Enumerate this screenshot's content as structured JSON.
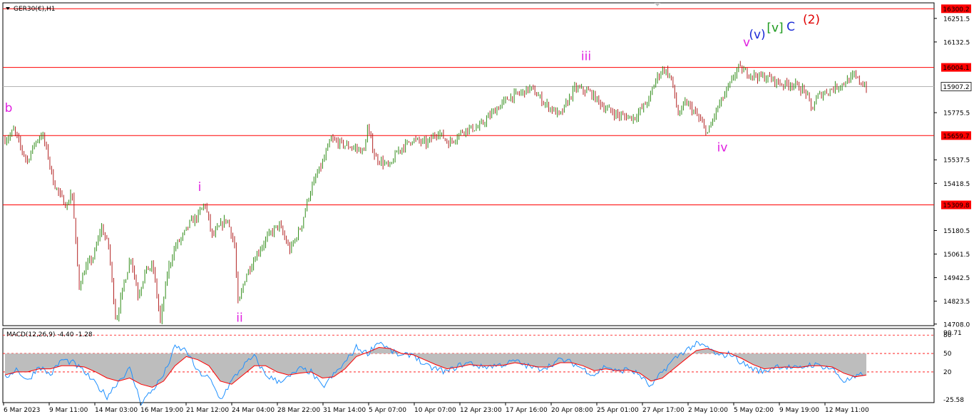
{
  "header": {
    "symbol_label": "GER30(€),H1",
    "macd_label": "MACD(12,26,9) -4.40 -1.28"
  },
  "colors": {
    "up_candle": "#2e8b16",
    "down_candle": "#b22222",
    "level_line": "#ff0000",
    "current_line": "#b4b4b4",
    "macd_hist": "#bdbdbd",
    "macd_main": "#1e90ff",
    "macd_signal": "#ff0000",
    "wave_magenta": "#e020e0",
    "wave_blue": "#1a2ad6",
    "wave_green": "#1c9a1c",
    "wave_red": "#e00000"
  },
  "chart_data": [
    {
      "type": "candlestick",
      "symbol": "GER30(€),H1",
      "ylim": [
        14700,
        16330
      ],
      "y_ticks": [
        "16251.5",
        "16132.5",
        "15775.5",
        "15537.5",
        "15418.5",
        "15180.5",
        "15061.5",
        "14942.5",
        "14823.5",
        "14708.0"
      ],
      "x_tick_labels": [
        "6 Mar 2023",
        "9 Mar 11:00",
        "14 Mar 03:00",
        "16 Mar 19:00",
        "21 Mar 12:00",
        "24 Mar 04:00",
        "28 Mar 22:00",
        "31 Mar 14:00",
        "5 Apr 07:00",
        "10 Apr 07:00",
        "12 Apr 23:00",
        "17 Apr 16:00",
        "20 Apr 08:00",
        "25 Apr 01:00",
        "27 Apr 17:00",
        "2 May 10:00",
        "5 May 02:00",
        "9 May 19:00",
        "12 May 11:00"
      ],
      "price_path": [
        [
          0,
          15640
        ],
        [
          0.007,
          15660
        ],
        [
          0.012,
          15690
        ],
        [
          0.02,
          15610
        ],
        [
          0.03,
          15530
        ],
        [
          0.04,
          15620
        ],
        [
          0.05,
          15670
        ],
        [
          0.058,
          15560
        ],
        [
          0.065,
          15430
        ],
        [
          0.075,
          15350
        ],
        [
          0.085,
          15300
        ],
        [
          0.09,
          15400
        ],
        [
          0.1,
          14900
        ],
        [
          0.11,
          15000
        ],
        [
          0.12,
          15050
        ],
        [
          0.13,
          15200
        ],
        [
          0.14,
          15100
        ],
        [
          0.15,
          14720
        ],
        [
          0.16,
          14900
        ],
        [
          0.17,
          15050
        ],
        [
          0.18,
          14850
        ],
        [
          0.19,
          14980
        ],
        [
          0.2,
          15000
        ],
        [
          0.21,
          14720
        ],
        [
          0.22,
          14980
        ],
        [
          0.23,
          15100
        ],
        [
          0.24,
          15150
        ],
        [
          0.25,
          15220
        ],
        [
          0.26,
          15250
        ],
        [
          0.27,
          15320
        ],
        [
          0.28,
          15150
        ],
        [
          0.29,
          15200
        ],
        [
          0.3,
          15240
        ],
        [
          0.31,
          15110
        ],
        [
          0.315,
          14800
        ],
        [
          0.325,
          14950
        ],
        [
          0.34,
          15060
        ],
        [
          0.355,
          15150
        ],
        [
          0.37,
          15210
        ],
        [
          0.385,
          15080
        ],
        [
          0.4,
          15200
        ],
        [
          0.41,
          15350
        ],
        [
          0.42,
          15450
        ],
        [
          0.43,
          15530
        ],
        [
          0.44,
          15640
        ],
        [
          0.46,
          15610
        ],
        [
          0.47,
          15600
        ],
        [
          0.485,
          15580
        ],
        [
          0.49,
          15700
        ],
        [
          0.5,
          15550
        ],
        [
          0.52,
          15500
        ],
        [
          0.53,
          15580
        ],
        [
          0.55,
          15640
        ],
        [
          0.57,
          15620
        ],
        [
          0.585,
          15680
        ],
        [
          0.6,
          15620
        ],
        [
          0.62,
          15690
        ],
        [
          0.64,
          15700
        ],
        [
          0.66,
          15780
        ],
        [
          0.68,
          15850
        ],
        [
          0.7,
          15880
        ],
        [
          0.71,
          15900
        ],
        [
          0.73,
          15820
        ],
        [
          0.75,
          15760
        ],
        [
          0.77,
          15900
        ],
        [
          0.79,
          15880
        ],
        [
          0.81,
          15800
        ],
        [
          0.83,
          15760
        ],
        [
          0.85,
          15750
        ],
        [
          0.87,
          15840
        ],
        [
          0.88,
          15950
        ],
        [
          0.89,
          16000
        ],
        [
          0.9,
          15950
        ],
        [
          0.91,
          15760
        ],
        [
          0.92,
          15830
        ],
        [
          0.935,
          15760
        ],
        [
          0.95,
          15670
        ],
        [
          0.96,
          15780
        ],
        [
          0.97,
          15850
        ],
        [
          0.98,
          15920
        ],
        [
          0.99,
          16004
        ],
        [
          1.0,
          15980
        ]
      ],
      "price_path_2": [
        [
          0,
          15980
        ],
        [
          0.1,
          15960
        ],
        [
          0.2,
          15950
        ],
        [
          0.3,
          15920
        ],
        [
          0.4,
          15920
        ],
        [
          0.5,
          15880
        ],
        [
          0.55,
          15790
        ],
        [
          0.6,
          15860
        ],
        [
          0.7,
          15890
        ],
        [
          0.8,
          15920
        ],
        [
          0.9,
          15960
        ],
        [
          0.95,
          15930
        ],
        [
          1.0,
          15907
        ]
      ],
      "levels": [
        {
          "value": 16300.2,
          "label": "16300.2",
          "kind": "resistance"
        },
        {
          "value": 16004.1,
          "label": "16004.1",
          "kind": "resistance"
        },
        {
          "value": 15907.2,
          "label": "15907.2",
          "kind": "current"
        },
        {
          "value": 15659.7,
          "label": "15659.7",
          "kind": "support"
        },
        {
          "value": 15309.8,
          "label": "15309.8",
          "kind": "support"
        }
      ],
      "wave_labels": [
        {
          "text": "b",
          "x_date": "6 Mar 2023",
          "price": 15780,
          "color": "#e020e0"
        },
        {
          "text": "i",
          "x_date": "21 Mar 12:00",
          "price": 15380,
          "color": "#e020e0"
        },
        {
          "text": "ii",
          "x_date": "24 Mar 04:00",
          "price": 14720,
          "color": "#e020e0"
        },
        {
          "text": "iii",
          "x_date": "20 Apr 08:00",
          "price": 16040,
          "color": "#e020e0"
        },
        {
          "text": "iv",
          "x_date": "2 May 10:00",
          "price": 15580,
          "color": "#e020e0"
        },
        {
          "text": "v",
          "x_date": "5 May 02:00",
          "price": 16110,
          "color": "#e020e0"
        },
        {
          "text": "(v)",
          "x_date": "5 May 02:00",
          "price": 16150,
          "color": "#1a2ad6"
        },
        {
          "text": "[v]",
          "x_date": "5 May 02:00",
          "price": 16185,
          "color": "#1c9a1c"
        },
        {
          "text": "C",
          "x_date": "5 May 02:00",
          "price": 16190,
          "color": "#1a2ad6"
        },
        {
          "text": "(2)",
          "x_date": "9 May 19:00",
          "price": 16225,
          "color": "#e00000"
        }
      ]
    },
    {
      "type": "line",
      "indicator": "MACD(12,26,9)",
      "main_value": -4.4,
      "signal_value": -1.28,
      "ylim": [
        -30,
        90.71
      ],
      "y_ticks": [
        "90.71",
        "80",
        "50",
        "20",
        "-25.58"
      ],
      "levels": [
        80,
        50,
        20
      ],
      "series": [
        {
          "name": "MACD",
          "values": [
            10,
            25,
            5,
            30,
            15,
            40,
            35,
            20,
            0,
            -20,
            5,
            25,
            -30,
            -10,
            15,
            60,
            55,
            20,
            10,
            -25,
            5,
            30,
            45,
            15,
            5,
            10,
            25,
            20,
            -5,
            15,
            35,
            60,
            50,
            70,
            55,
            45,
            50,
            30,
            25,
            20,
            30,
            35,
            28,
            30,
            32,
            38,
            30,
            25,
            30,
            40,
            35,
            25,
            15,
            30,
            20,
            25,
            15,
            -5,
            20,
            40,
            55,
            65,
            60,
            45,
            50,
            35,
            25,
            20,
            30,
            28,
            25,
            32,
            30,
            25,
            5,
            10,
            20
          ]
        },
        {
          "name": "Signal",
          "values": [
            15,
            20,
            20,
            25,
            25,
            30,
            30,
            28,
            20,
            10,
            5,
            10,
            0,
            -5,
            5,
            30,
            45,
            40,
            30,
            5,
            0,
            15,
            30,
            30,
            20,
            15,
            18,
            20,
            10,
            12,
            25,
            45,
            52,
            60,
            58,
            50,
            48,
            40,
            32,
            25,
            28,
            32,
            30,
            30,
            31,
            35,
            32,
            28,
            28,
            35,
            35,
            30,
            22,
            25,
            22,
            23,
            18,
            5,
            10,
            25,
            40,
            55,
            58,
            52,
            50,
            42,
            32,
            25,
            27,
            28,
            27,
            30,
            30,
            28,
            18,
            12,
            15
          ]
        }
      ]
    }
  ]
}
